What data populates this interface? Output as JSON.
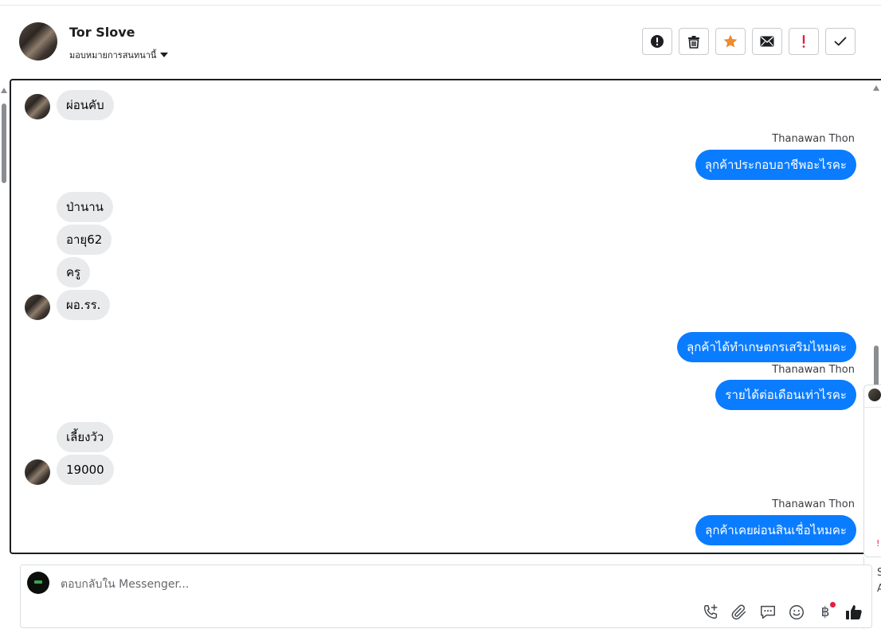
{
  "header": {
    "name": "Tor Slove",
    "assign_label": "มอบหมายการสนทนานี้",
    "actions": [
      {
        "name": "spam-button",
        "icon": "exclamation-circle-icon"
      },
      {
        "name": "delete-button",
        "icon": "trash-icon"
      },
      {
        "name": "star-button",
        "icon": "star-icon",
        "color": "#f28c28"
      },
      {
        "name": "email-button",
        "icon": "envelope-icon"
      },
      {
        "name": "important-button",
        "icon": "exclamation-icon",
        "color": "#e41e3f"
      },
      {
        "name": "done-button",
        "icon": "checkmark-icon"
      }
    ]
  },
  "messages": [
    {
      "dir": "in",
      "text": "ผ่อนคับ"
    },
    {
      "sender": "Thanawan Thon"
    },
    {
      "dir": "out",
      "text": "ลุกค้าประกอบอาชีพอะไรคะ"
    },
    {
      "dir": "in",
      "text": "ป่านาน"
    },
    {
      "dir": "in",
      "text": "อายุ62"
    },
    {
      "dir": "in",
      "text": "ครู"
    },
    {
      "dir": "in",
      "text": "ผอ.รร."
    },
    {
      "dir": "out",
      "text": "ลุกค้าได้ทำเกษตกรเสริมไหมคะ"
    },
    {
      "sender": "Thanawan Thon"
    },
    {
      "dir": "out",
      "text": "รายได้ต่อเดือนเท่าไรคะ"
    },
    {
      "dir": "in",
      "text": "เลี้ยงวัว"
    },
    {
      "dir": "in",
      "text": "19000"
    },
    {
      "sender": "Thanawan Thon"
    },
    {
      "dir": "out",
      "text": "ลุกค้าเคยผ่อนสินเชื่อไหมคะ"
    }
  ],
  "side_panel": {
    "line1": "S",
    "line2": "A",
    "mark": "!!"
  },
  "composer": {
    "placeholder": "ตอบกลับใน Messenger...",
    "baht_symbol": "฿",
    "tools": [
      "phone-plus-icon",
      "paperclip-icon",
      "chat-bubble-icon",
      "emoji-icon",
      "baht-icon",
      "thumbs-up-icon"
    ]
  },
  "colors": {
    "outgoing_bubble": "#0a7cff",
    "incoming_bubble": "#e9eaec",
    "notification_dot": "#e41e3f"
  }
}
